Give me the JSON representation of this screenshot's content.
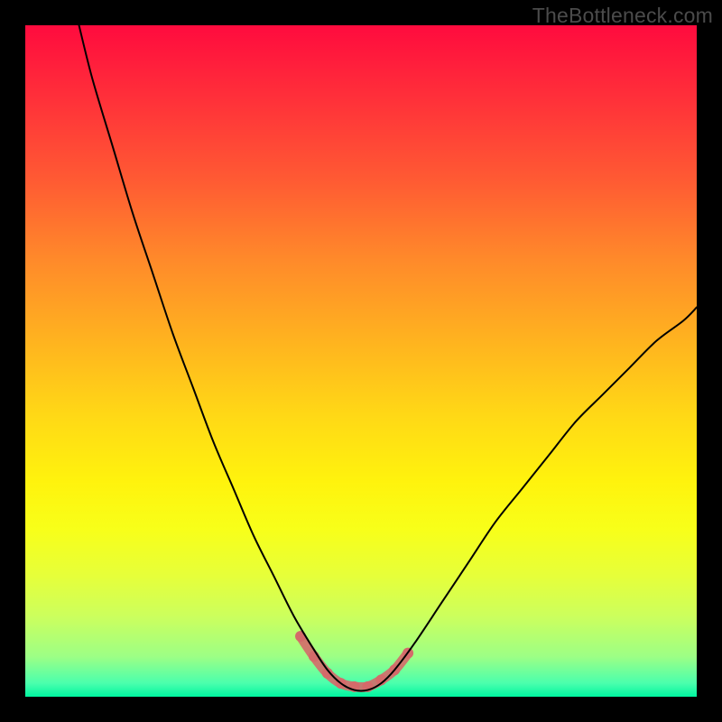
{
  "watermark": "TheBottleneck.com",
  "chart_data": {
    "type": "line",
    "title": "",
    "xlabel": "",
    "ylabel": "",
    "xlim": [
      0,
      100
    ],
    "ylim": [
      0,
      100
    ],
    "gradient_stops": [
      {
        "pos": 0,
        "color": "#ff0b3e"
      },
      {
        "pos": 10,
        "color": "#ff2d3a"
      },
      {
        "pos": 23,
        "color": "#ff5a33"
      },
      {
        "pos": 35,
        "color": "#ff8a2a"
      },
      {
        "pos": 47,
        "color": "#ffb31f"
      },
      {
        "pos": 58,
        "color": "#ffd816"
      },
      {
        "pos": 68,
        "color": "#fff30d"
      },
      {
        "pos": 75,
        "color": "#f8ff19"
      },
      {
        "pos": 82,
        "color": "#e6ff3a"
      },
      {
        "pos": 88,
        "color": "#ccff5d"
      },
      {
        "pos": 94,
        "color": "#9dff85"
      },
      {
        "pos": 98,
        "color": "#4affad"
      },
      {
        "pos": 100,
        "color": "#00f5a0"
      }
    ],
    "series": [
      {
        "name": "main-curve",
        "stroke": "#000000",
        "stroke_width": 2,
        "x": [
          8,
          10,
          13,
          16,
          19,
          22,
          25,
          28,
          31,
          34,
          37,
          40,
          43,
          45,
          47,
          49,
          51,
          53,
          55,
          58,
          62,
          66,
          70,
          74,
          78,
          82,
          86,
          90,
          94,
          98,
          100
        ],
        "y": [
          100,
          92,
          82,
          72,
          63,
          54,
          46,
          38,
          31,
          24,
          18,
          12,
          7,
          4,
          2,
          1,
          1,
          2,
          4,
          8,
          14,
          20,
          26,
          31,
          36,
          41,
          45,
          49,
          53,
          56,
          58
        ]
      },
      {
        "name": "highlight-band",
        "stroke": "#d46a6a",
        "stroke_width": 11,
        "opacity": 0.9,
        "x": [
          41,
          43,
          45,
          47,
          49,
          51,
          53,
          55,
          57
        ],
        "y": [
          9,
          6,
          3.5,
          2,
          1.5,
          1.5,
          2.5,
          4,
          6.5
        ]
      }
    ],
    "highlight_markers": {
      "color": "#d46a6a",
      "radius": 6,
      "points": [
        {
          "x": 41,
          "y": 9
        },
        {
          "x": 43,
          "y": 6
        },
        {
          "x": 45,
          "y": 3.5
        },
        {
          "x": 47,
          "y": 2
        },
        {
          "x": 49,
          "y": 1.5
        },
        {
          "x": 51,
          "y": 1.5
        },
        {
          "x": 53,
          "y": 2.5
        },
        {
          "x": 55,
          "y": 4
        },
        {
          "x": 57,
          "y": 6.5
        }
      ]
    }
  }
}
